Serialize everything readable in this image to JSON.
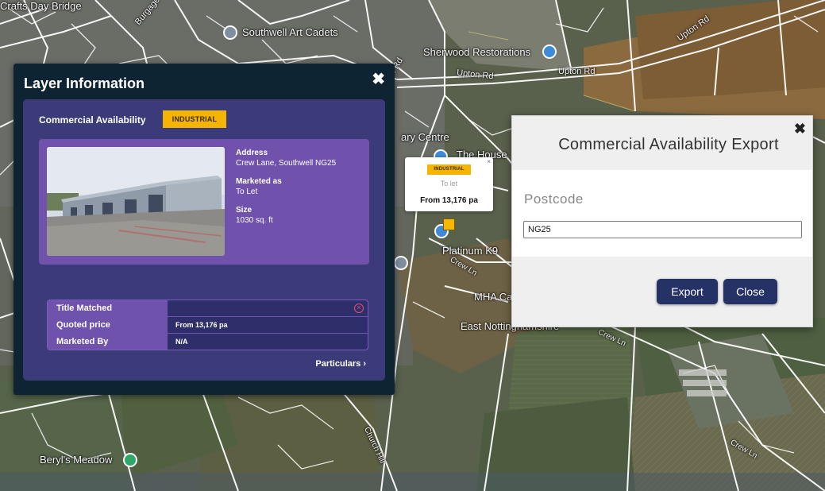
{
  "map": {
    "labels": [
      "Crafts Day Bridge",
      "Burgage",
      "Southwell Art Cadets",
      "Sherwood Restorations",
      "Upton Rd",
      "Upton Rd",
      "Upton Rd",
      "Upton Rd",
      "ary Centre",
      "The House",
      "Platinum K9",
      "Crew Ln",
      "MHA Care",
      "East Nottinghamshire",
      "Beryl's Meadow",
      "Crew Ln",
      "Crew Ln",
      "Church Hill"
    ]
  },
  "layer_panel": {
    "title": "Layer Information",
    "category": "Commercial Availability",
    "badge": "INDUSTRIAL",
    "address_label": "Address",
    "address_value": "Crew Lane, Southwell NG25",
    "marketed_as_label": "Marketed as",
    "marketed_as_value": "To Let",
    "size_label": "Size",
    "size_value": "1030 sq. ft",
    "rows": [
      {
        "label": "Title Matched",
        "value": ""
      },
      {
        "label": "Quoted price",
        "value": "From 13,176 pa"
      },
      {
        "label": "Marketed By",
        "value": "N/A"
      }
    ],
    "particulars_link": "Particulars ›"
  },
  "map_popup": {
    "badge": "INDUSTRIAL",
    "status": "To let",
    "price": "From 13,176 pa",
    "close": "×"
  },
  "export_dialog": {
    "title": "Commercial Availability Export",
    "postcode_label": "Postcode",
    "postcode_value": "NG25",
    "export_button": "Export",
    "close_button": "Close"
  },
  "colors": {
    "panel_dark": "#0f2433",
    "panel_inner": "#3a3b78",
    "card_purple": "#7052ac",
    "badge_yellow": "#f4b400",
    "button_navy": "#253266"
  }
}
